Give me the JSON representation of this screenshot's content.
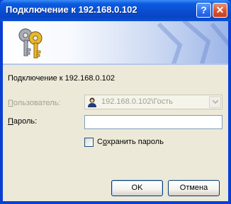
{
  "window": {
    "title": "Подключение к 192.168.0.102",
    "help_glyph": "?",
    "close_glyph": "✕"
  },
  "banner": {
    "icon": "keys-icon",
    "watermark_icon": "network-watermark-icon"
  },
  "form": {
    "connect_to": "Подключение к 192.168.0.102",
    "user_label_pre": "",
    "user_label_ul": "П",
    "user_label_post": "ользователь:",
    "user_value": "192.168.0.102\\Гость",
    "user_icon": "user-icon",
    "password_label_pre": "",
    "password_label_ul": "П",
    "password_label_post": "ароль:",
    "password_value": "",
    "remember_label_pre": "С",
    "remember_label_ul": "о",
    "remember_label_post": "хранить пароль",
    "remember_checked": false
  },
  "buttons": {
    "ok": "OK",
    "cancel": "Отмена"
  }
}
